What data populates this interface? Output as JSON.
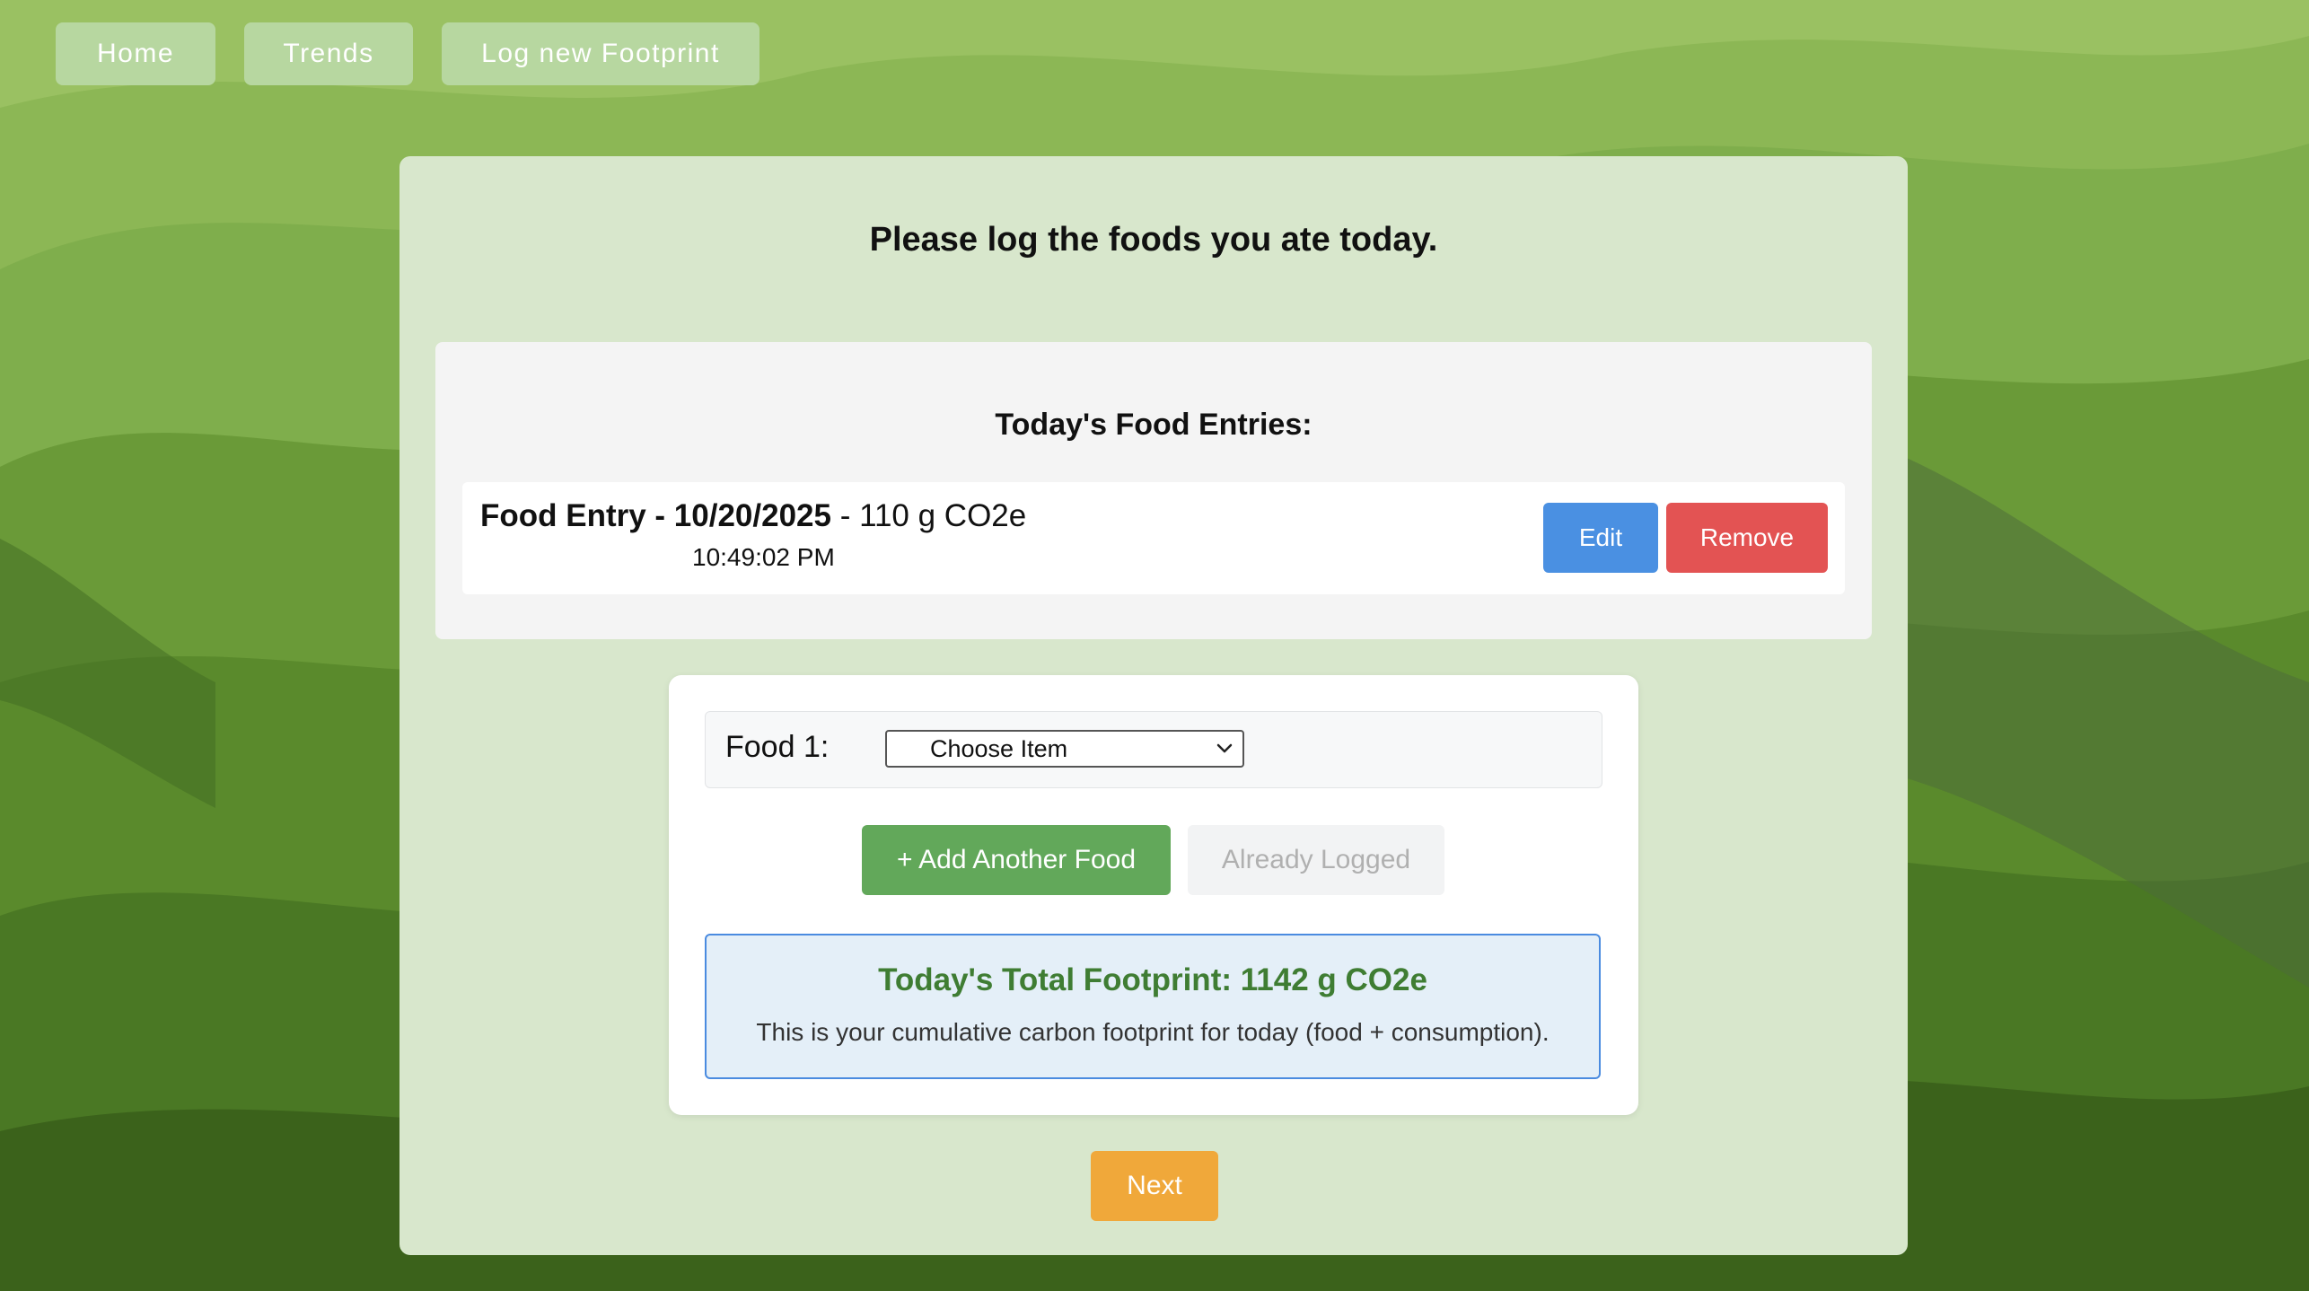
{
  "nav": {
    "home_label": "Home",
    "trends_label": "Trends",
    "log_label": "Log new Footprint"
  },
  "main": {
    "prompt": "Please log the foods you ate today."
  },
  "entries": {
    "heading": "Today's Food Entries:",
    "items": [
      {
        "title": "Food Entry - 10/20/2025",
        "footprint": " - 110 g CO2e",
        "time": "10:49:02 PM",
        "edit_label": "Edit",
        "remove_label": "Remove"
      }
    ]
  },
  "form": {
    "food_label": "Food 1:",
    "select_value": "Choose Item",
    "add_label": "+ Add Another Food",
    "logged_label": "Already Logged",
    "total_title": "Today's Total Footprint: 1142 g CO2e",
    "total_subtitle": "This is your cumulative carbon footprint for today (food + consumption)."
  },
  "next_label": "Next",
  "colors": {
    "nav_button": "#b7d7a0",
    "panel": "#d8e7cc",
    "edit": "#4a90e2",
    "remove": "#e35353",
    "add": "#62a85a",
    "next": "#f0a83a",
    "total_title": "#3f7d33",
    "total_border": "#4a8be0"
  }
}
